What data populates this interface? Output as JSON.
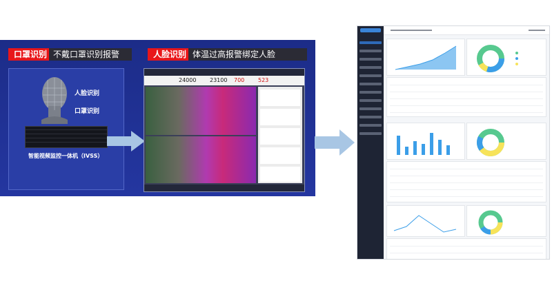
{
  "left": {
    "mask_tag": "口罩识别",
    "mask_caption": "不戴口罩识别报警",
    "face_tag": "人脸识别",
    "face_caption": "体温过高报警绑定人脸",
    "face_label": "人脸识别",
    "mask_label": "口罩识别",
    "device_caption": "智能视频监控一体机（IVSS）",
    "thermal": {
      "stat1": "24000",
      "stat2": "23100",
      "stat3": "700",
      "stat4": "523"
    }
  },
  "colors": {
    "banner_blue": "#2436a0",
    "tag_red": "#e8161a",
    "arrow": "#a8c6e4",
    "chart_blue": "#3b9ee8",
    "donut_green": "#57c98f",
    "donut_blue": "#3b9ee8",
    "donut_yellow": "#f7e35a"
  },
  "icons": [
    "mannequin-head-icon",
    "server-device-icon",
    "arrow-right-icon"
  ]
}
